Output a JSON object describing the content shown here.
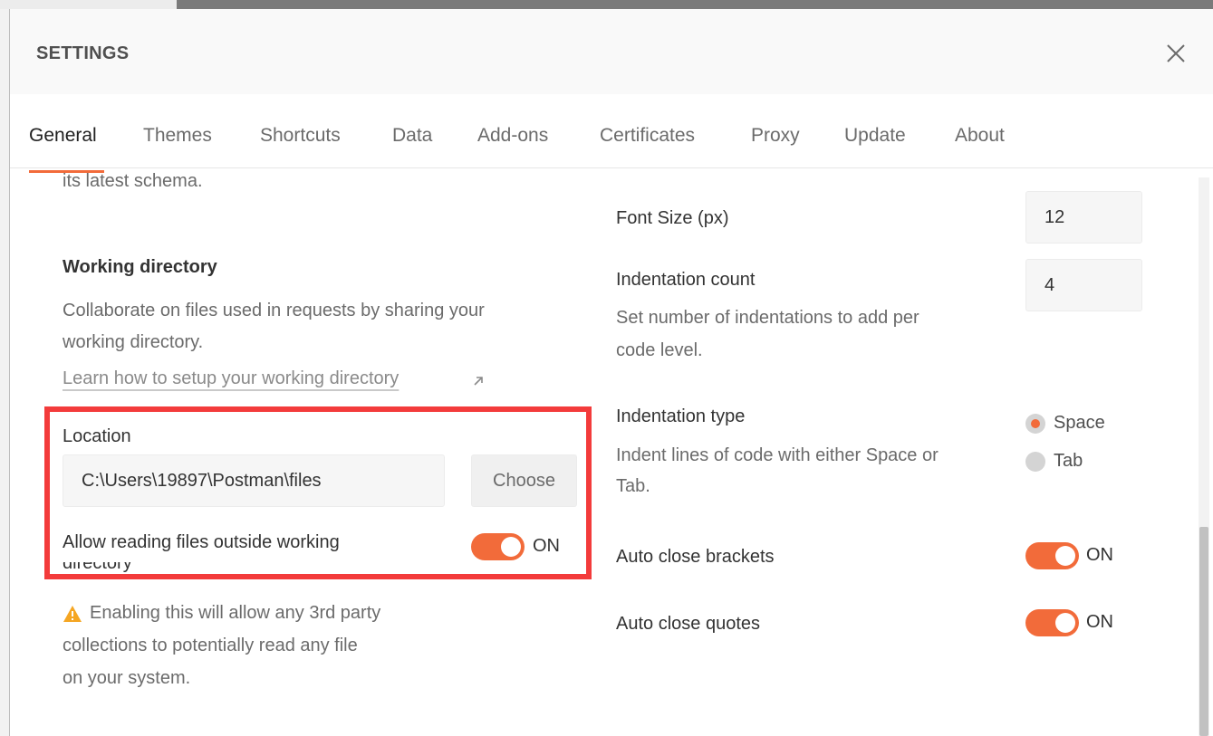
{
  "dialog": {
    "title": "SETTINGS"
  },
  "tabs": [
    {
      "label": "General",
      "active": true
    },
    {
      "label": "Themes"
    },
    {
      "label": "Shortcuts"
    },
    {
      "label": "Data"
    },
    {
      "label": "Add-ons"
    },
    {
      "label": "Certificates"
    },
    {
      "label": "Proxy"
    },
    {
      "label": "Update"
    },
    {
      "label": "About"
    }
  ],
  "left": {
    "partial_text": "its latest schema.",
    "working_directory": {
      "heading": "Working directory",
      "desc_line1": "Collaborate on files used in requests by sharing your",
      "desc_line2": "working directory.",
      "link": "Learn how to setup your working directory",
      "location_label": "Location",
      "location_value": "C:\\Users\\19897\\Postman\\files",
      "choose_button": "Choose",
      "allow_label_line1": "Allow reading files outside working",
      "allow_label_line2": "directory",
      "allow_toggle": "ON",
      "warning_line1": "Enabling this will allow any 3rd party",
      "warning_line2": "collections to potentially read any file",
      "warning_line3": "on your system."
    }
  },
  "right": {
    "font_size": {
      "label": "Font Size (px)",
      "value": "12"
    },
    "indentation_count": {
      "label": "Indentation count",
      "value": "4",
      "desc_line1": "Set number of indentations to add per",
      "desc_line2": "code level."
    },
    "indentation_type": {
      "label": "Indentation type",
      "desc_line1": "Indent lines of code with either Space or",
      "desc_line2": "Tab.",
      "options": [
        "Space",
        "Tab"
      ],
      "selected": "Space"
    },
    "auto_close_brackets": {
      "label": "Auto close brackets",
      "toggle": "ON"
    },
    "auto_close_quotes": {
      "label": "Auto close quotes",
      "toggle": "ON"
    }
  },
  "colors": {
    "accent": "#f26b3a",
    "highlight": "#f33b3b",
    "warning": "#f5a623"
  }
}
